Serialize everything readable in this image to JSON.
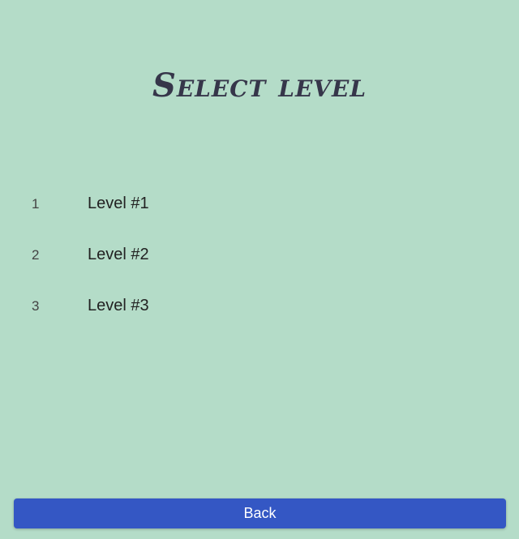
{
  "page": {
    "title": "Select level"
  },
  "levels": [
    {
      "number": "1",
      "label": "Level #1"
    },
    {
      "number": "2",
      "label": "Level #2"
    },
    {
      "number": "3",
      "label": "Level #3"
    }
  ],
  "footer": {
    "back_label": "Back"
  },
  "colors": {
    "background": "#b4dcc8",
    "button": "#3457c4",
    "title": "#36364a"
  }
}
